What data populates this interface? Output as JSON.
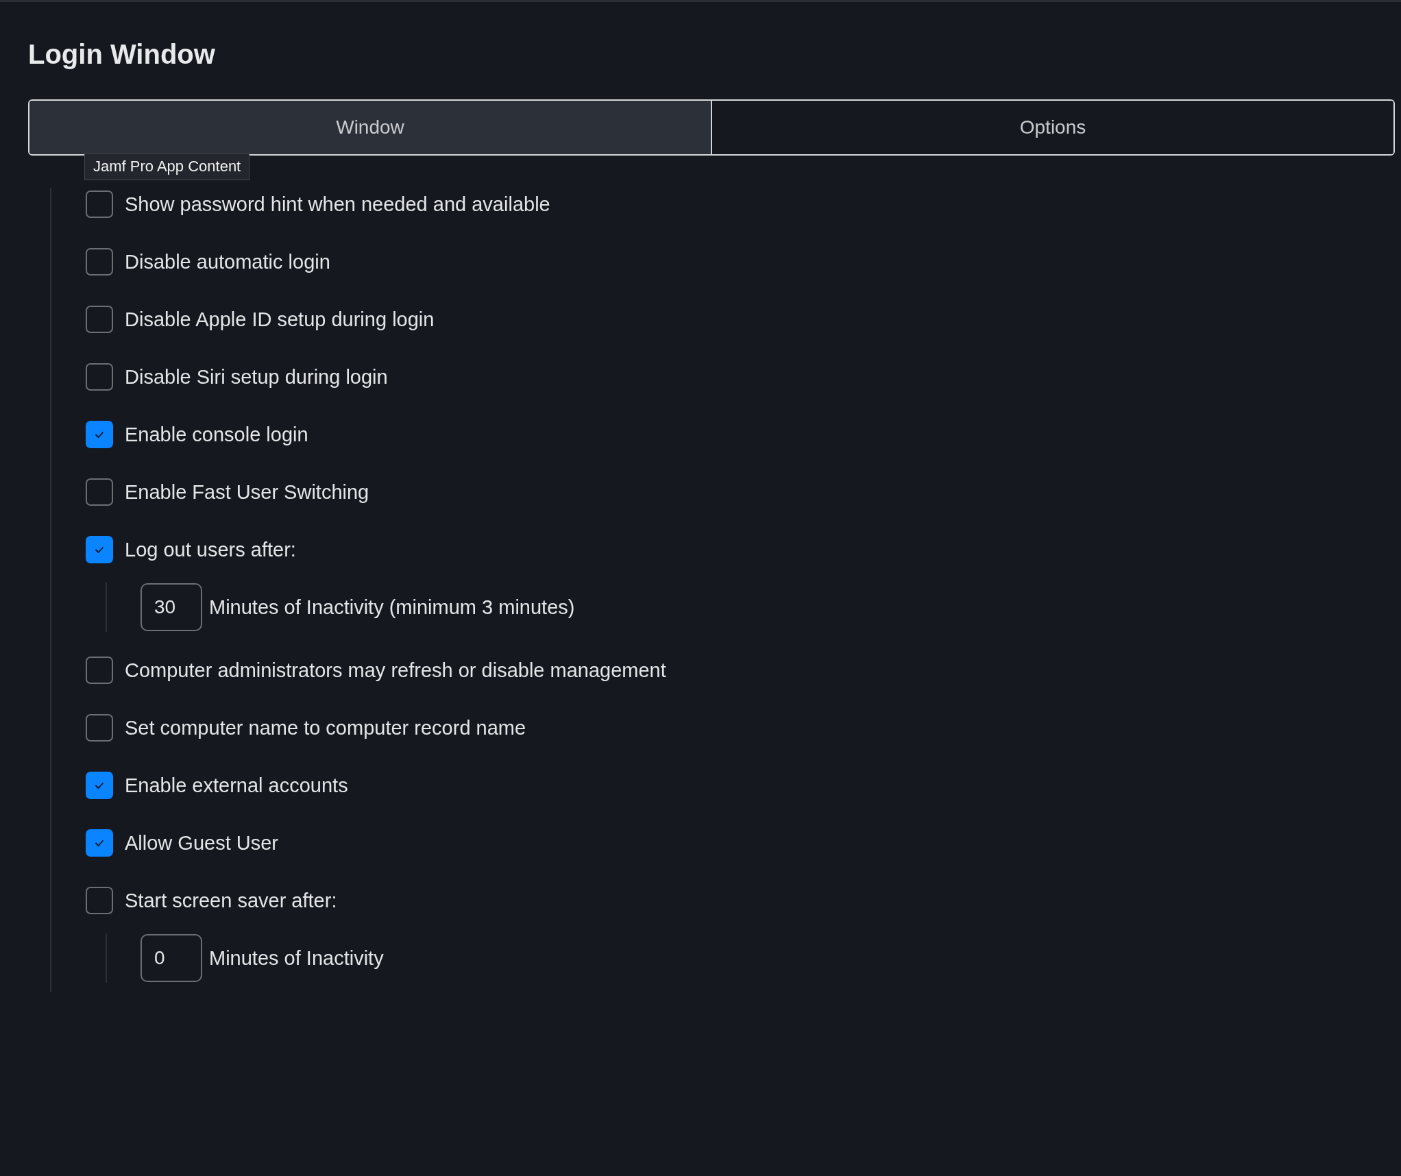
{
  "page": {
    "title": "Login Window"
  },
  "tabs": [
    {
      "label": "Window",
      "selected": true
    },
    {
      "label": "Options",
      "selected": false
    }
  ],
  "tooltip": "Jamf Pro App Content",
  "settings": [
    {
      "label": "Show password hint when needed and available",
      "checked": false
    },
    {
      "label": "Disable automatic login",
      "checked": false
    },
    {
      "label": "Disable Apple ID setup during login",
      "checked": false
    },
    {
      "label": "Disable Siri setup during login",
      "checked": false
    },
    {
      "label": "Enable console login",
      "checked": true
    },
    {
      "label": "Enable Fast User Switching",
      "checked": false
    },
    {
      "label": "Log out users after:",
      "checked": true,
      "sub": {
        "value": "30",
        "label": "Minutes of Inactivity (minimum 3 minutes)"
      }
    },
    {
      "label": "Computer administrators may refresh or disable management",
      "checked": false
    },
    {
      "label": "Set computer name to computer record name",
      "checked": false
    },
    {
      "label": "Enable external accounts",
      "checked": true
    },
    {
      "label": "Allow Guest User",
      "checked": true
    },
    {
      "label": "Start screen saver after:",
      "checked": false,
      "sub": {
        "value": "0",
        "label": "Minutes of Inactivity"
      }
    }
  ]
}
